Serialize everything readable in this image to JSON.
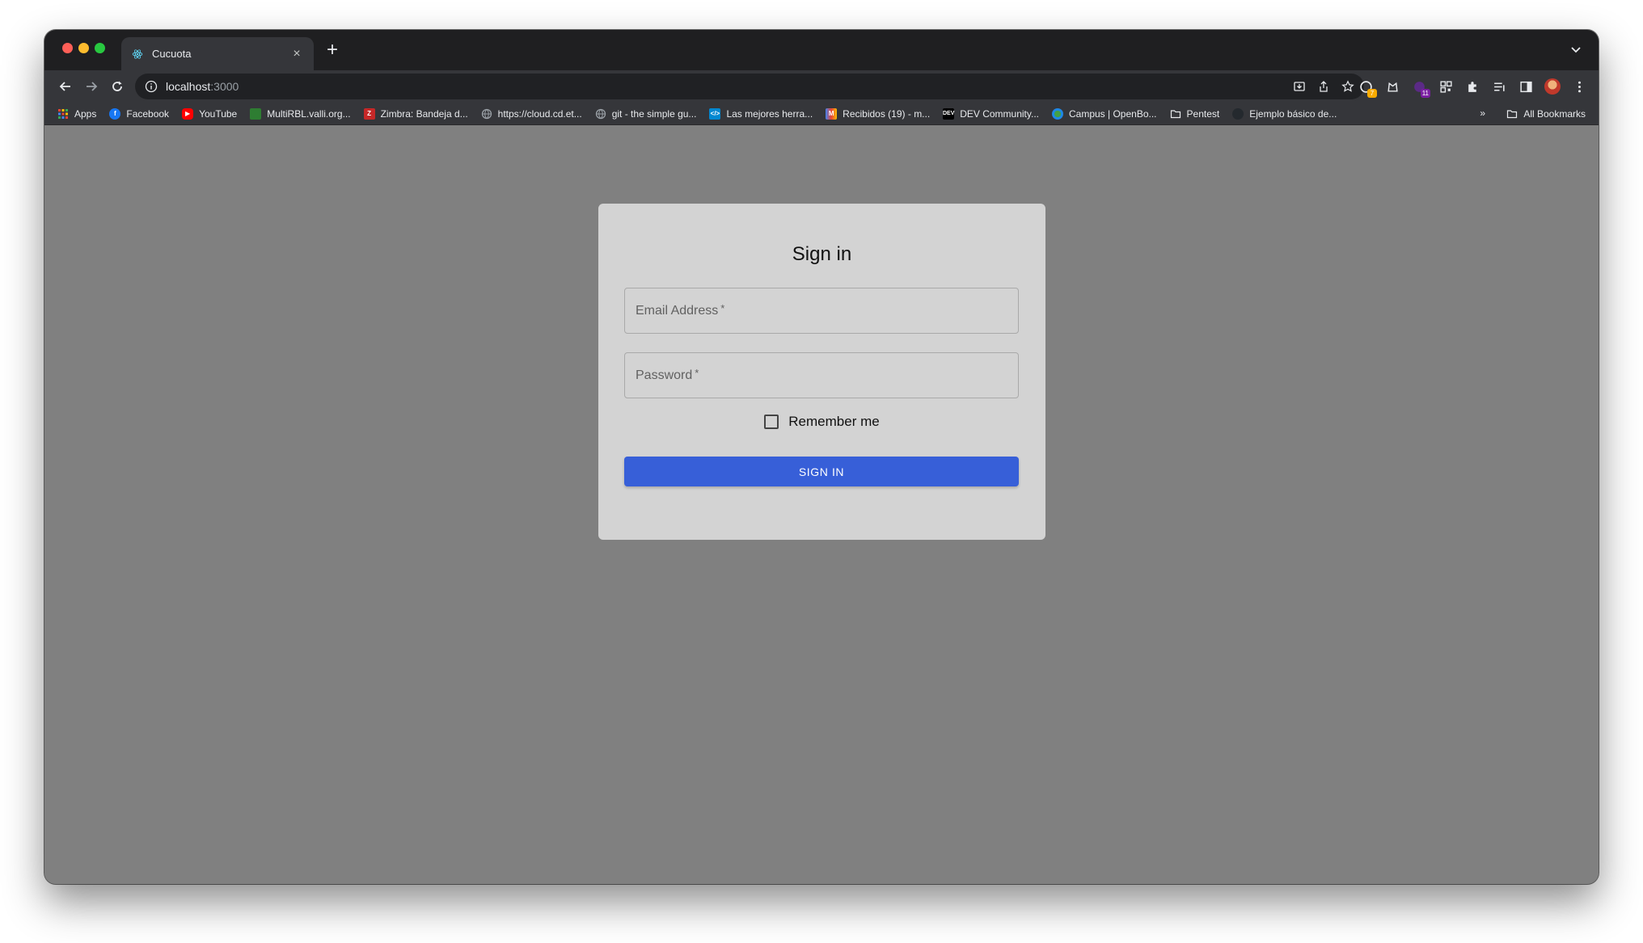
{
  "browser": {
    "tab_title": "Cucuota",
    "url_host": "localhost",
    "url_rest": ":3000",
    "new_tab_label": "+",
    "tab_close_label": "×",
    "extension_badges": [
      "7",
      "11"
    ]
  },
  "bookmarks": {
    "items": [
      {
        "label": "Apps",
        "icon": "apps-grid-icon",
        "color": "#ea4335"
      },
      {
        "label": "Facebook",
        "icon": "facebook-icon",
        "color": "#1877f2"
      },
      {
        "label": "YouTube",
        "icon": "youtube-icon",
        "color": "#ff0000"
      },
      {
        "label": "MultiRBL.valli.org...",
        "icon": "multirbl-icon",
        "color": "#2e7d32"
      },
      {
        "label": "Zimbra: Bandeja d...",
        "icon": "zimbra-icon",
        "color": "#c62828"
      },
      {
        "label": "https://cloud.cd.et...",
        "icon": "globe-icon",
        "color": "#9aa0a6"
      },
      {
        "label": "git - the simple gu...",
        "icon": "globe-icon",
        "color": "#9aa0a6"
      },
      {
        "label": "Las mejores herra...",
        "icon": "code-icon",
        "color": "#0288d1"
      },
      {
        "label": "Recibidos (19) - m...",
        "icon": "gmail-icon",
        "color": "#ea4335"
      },
      {
        "label": "DEV Community...",
        "icon": "dev-icon",
        "color": "#000000"
      },
      {
        "label": "Campus | OpenBo...",
        "icon": "campus-icon",
        "color": "#1e88e5"
      },
      {
        "label": "Pentest",
        "icon": "folder-icon",
        "color": "#9aa0a6"
      },
      {
        "label": "Ejemplo básico de...",
        "icon": "github-icon",
        "color": "#24292e"
      }
    ],
    "overflow_label": "»",
    "all_bookmarks_label": "All Bookmarks"
  },
  "signin": {
    "title": "Sign in",
    "email_label": "Email Address",
    "password_label": "Password",
    "required_mark": "*",
    "remember_label": "Remember me",
    "remember_checked": false,
    "button_label": "SIGN IN"
  },
  "colors": {
    "page_background": "#808080",
    "card_background": "#d3d3d3",
    "primary_button": "#375fd8"
  }
}
